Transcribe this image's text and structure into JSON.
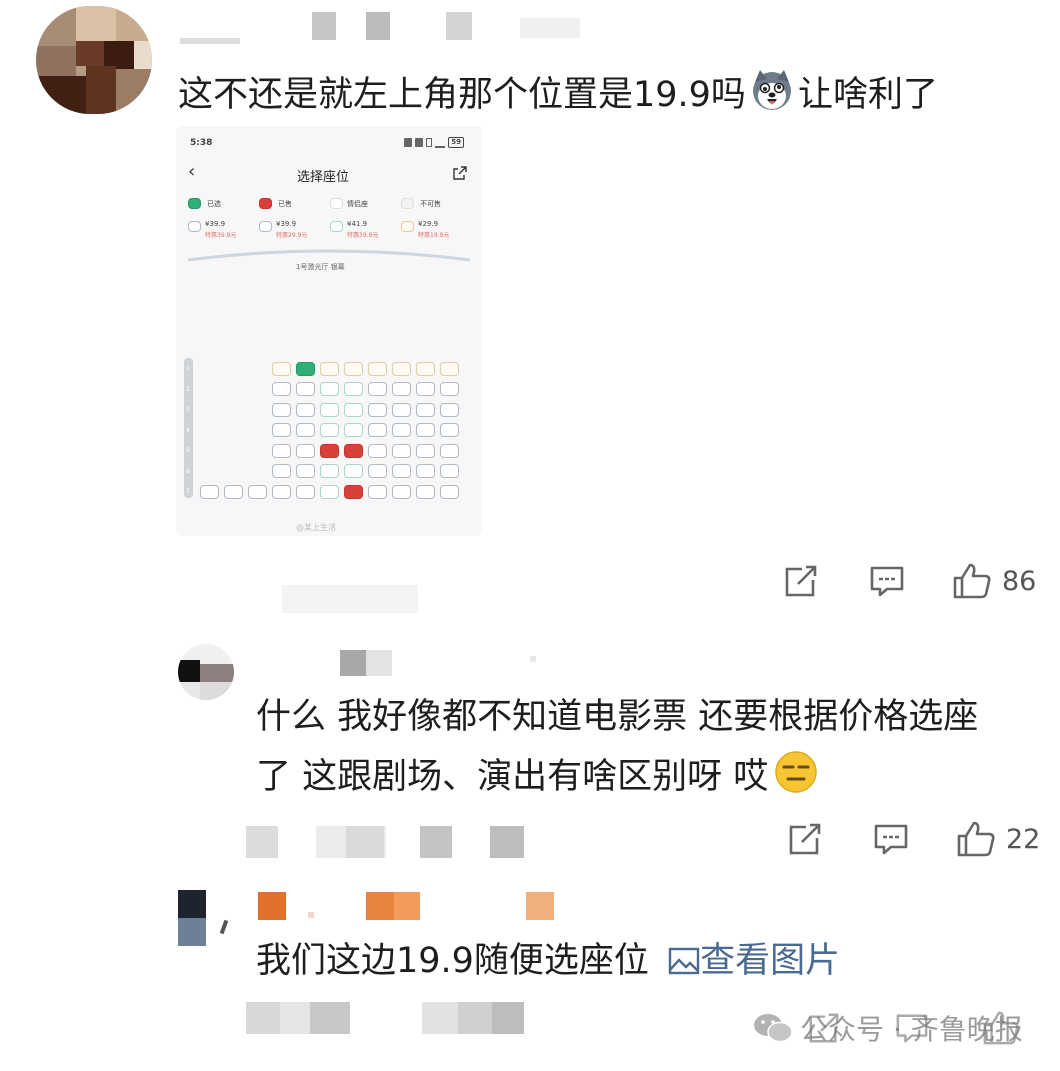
{
  "comments": [
    {
      "text": "这不还是就左上角那个位置是19.9吗",
      "text_after_emoji": "让啥利了",
      "emoji": "husky-dog-emoji",
      "likes": "86"
    },
    {
      "line1": "什么 我好像都不知道电影票 还要根据价格选座",
      "line2": "了 这跟剧场、演出有啥区别呀 哎",
      "emoji": "expressionless-face-emoji",
      "likes": "22"
    },
    {
      "text": "我们这边19.9随便选座位",
      "image_link": "查看图片"
    }
  ],
  "screenshot": {
    "time": "5:38",
    "battery": "59",
    "title": "选择座位",
    "legend": [
      {
        "label": "已选"
      },
      {
        "label": "已售"
      },
      {
        "label": "情侣座"
      },
      {
        "label": "不可售"
      }
    ],
    "prices": [
      {
        "price": "¥39.9",
        "special": "特惠39.9元"
      },
      {
        "price": "¥39.9",
        "special": "特惠29.9元"
      },
      {
        "price": "¥41.9",
        "special": "特惠39.9元"
      },
      {
        "price": "¥29.9",
        "special": "特惠19.9元"
      }
    ],
    "screen_label": "1号激光厅 银幕",
    "row_numbers": [
      "1",
      "2",
      "3",
      "4",
      "5",
      "6",
      "7"
    ],
    "watermark": "@某上生活"
  },
  "watermark": {
    "text": "公众号 · 齐鲁晚报"
  },
  "colors": {
    "sold": "#d9403a",
    "selected": "#2fae76",
    "link": "#4a6a92",
    "icon": "#666666"
  }
}
